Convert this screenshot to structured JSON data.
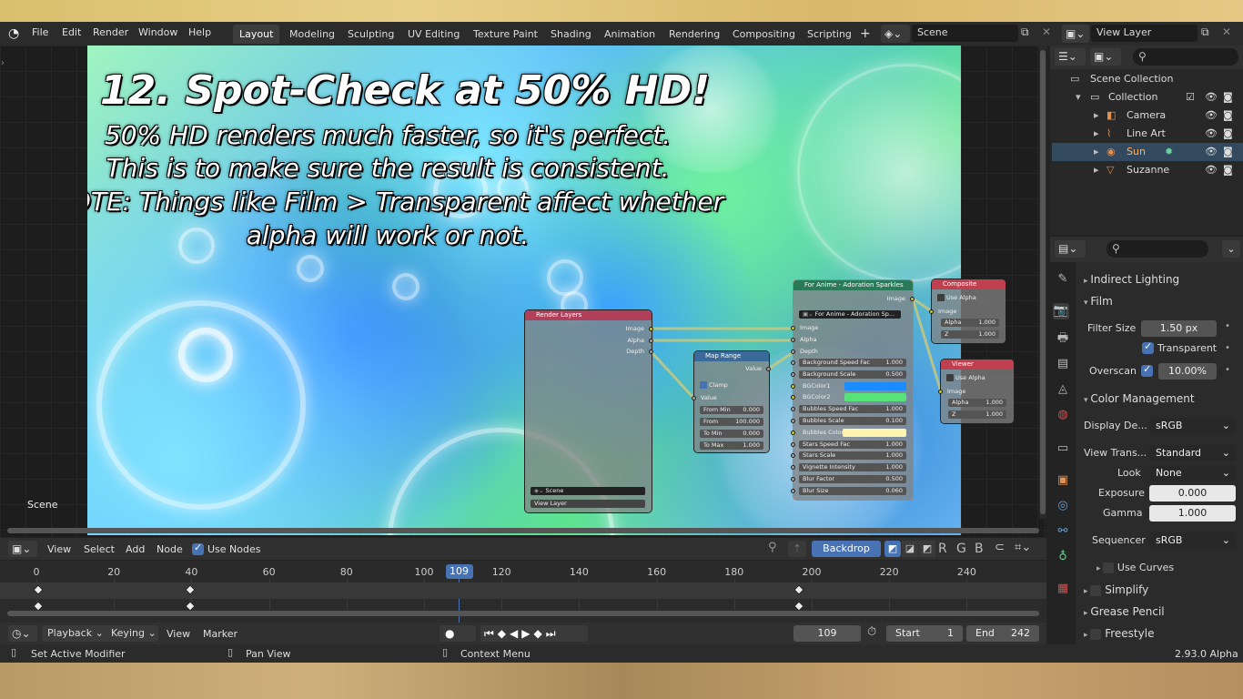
{
  "menu": {
    "file": "File",
    "edit": "Edit",
    "render": "Render",
    "window": "Window",
    "help": "Help"
  },
  "workspaces": [
    "Layout",
    "Modeling",
    "Sculpting",
    "UV Editing",
    "Texture Paint",
    "Shading",
    "Animation",
    "Rendering",
    "Compositing",
    "Scripting"
  ],
  "scene_field": "Scene",
  "view_layer_field": "View Layer",
  "tutorial": {
    "title": "12. Spot-Check at 50% HD!",
    "line1": "50% HD renders much faster, so it's perfect.",
    "line2": "This is to make sure the result is consistent.",
    "line3": "NOTE: Things like Film > Transparent affect whether",
    "line4": "alpha will work or not."
  },
  "scene_label": "Scene",
  "nodes": {
    "render_layers": {
      "title": "Render Layers",
      "outputs": [
        "Image",
        "Alpha",
        "Depth"
      ],
      "scene": "Scene",
      "view_layer": "View Layer"
    },
    "map_range": {
      "title": "Map Range",
      "out": "Value",
      "clamp": "Clamp",
      "in": "Value",
      "rows": [
        [
          "From Min",
          "0.000"
        ],
        [
          "From",
          "100.000"
        ],
        [
          "To Min",
          "0.000"
        ],
        [
          "To Max",
          "1.000"
        ]
      ]
    },
    "group": {
      "title": "For Anime - Adoration Sparkles",
      "selector": "For Anime - Adoration Sp...",
      "out": "Image",
      "inputs": [
        "Image",
        "Alpha",
        "Depth"
      ],
      "rows": [
        [
          "Background Speed Fac",
          "1.000"
        ],
        [
          "Background Scale",
          "0.500"
        ],
        [
          "BGColor1",
          ""
        ],
        [
          "BGColor2",
          ""
        ],
        [
          "Bubbles Speed Fac",
          "1.000"
        ],
        [
          "Bubbles Scale",
          "0.100"
        ],
        [
          "Bubbles Color",
          ""
        ],
        [
          "Stars Speed Fac",
          "1.000"
        ],
        [
          "Stars Scale",
          "1.000"
        ],
        [
          "Vignette Intensity",
          "1.000"
        ],
        [
          "Blur Factor",
          "0.500"
        ],
        [
          "Blur Size",
          "0.060"
        ]
      ]
    },
    "composite": {
      "title": "Composite",
      "use_alpha": "Use Alpha",
      "image": "Image",
      "alpha": [
        "Alpha",
        "1.000"
      ],
      "z": [
        "Z",
        "1.000"
      ]
    },
    "viewer": {
      "title": "Viewer",
      "use_alpha": "Use Alpha",
      "image": "Image",
      "alpha": [
        "Alpha",
        "1.000"
      ],
      "z": [
        "Z",
        "1.000"
      ]
    }
  },
  "node_header": {
    "view": "View",
    "select": "Select",
    "add": "Add",
    "node": "Node",
    "use_nodes": "Use Nodes",
    "backdrop": "Backdrop",
    "channels": [
      "R",
      "G",
      "B"
    ]
  },
  "timeline": {
    "ticks": [
      "0",
      "20",
      "40",
      "60",
      "80",
      "100",
      "109",
      "120",
      "140",
      "160",
      "180",
      "200",
      "220",
      "240"
    ],
    "playback": "Playback",
    "keying": "Keying",
    "view": "View",
    "marker": "Marker",
    "current_frame": "109",
    "start_label": "Start",
    "start": "1",
    "end_label": "End",
    "end": "242"
  },
  "status": {
    "left": "Set Active Modifier",
    "mid": "Pan View",
    "right": "Context Menu",
    "version": "2.93.0 Alpha"
  },
  "outliner": {
    "scene_collection": "Scene Collection",
    "collection": "Collection",
    "items": [
      "Camera",
      "Line Art",
      "Sun",
      "Suzanne"
    ]
  },
  "props": {
    "indirect_lighting": "Indirect Lighting",
    "film": "Film",
    "filter_size_label": "Filter Size",
    "filter_size": "1.50 px",
    "transparent": "Transparent",
    "overscan_label": "Overscan",
    "overscan": "10.00%",
    "color_management": "Color Management",
    "display_label": "Display De...",
    "display": "sRGB",
    "view_label": "View Trans...",
    "view": "Standard",
    "look_label": "Look",
    "look": "None",
    "exposure_label": "Exposure",
    "exposure": "0.000",
    "gamma_label": "Gamma",
    "gamma": "1.000",
    "sequencer_label": "Sequencer",
    "sequencer": "sRGB",
    "use_curves": "Use Curves",
    "simplify": "Simplify",
    "grease_pencil": "Grease Pencil",
    "freestyle": "Freestyle"
  },
  "colors": {
    "accent": "#4772b3",
    "render_layers_header": "#b0405a",
    "group_header": "#2a7a5a",
    "output_header": "#c04050",
    "bgcolor1": "#1a8cff",
    "bgcolor2": "#55e37a",
    "bubbles": "#fff3b0"
  }
}
